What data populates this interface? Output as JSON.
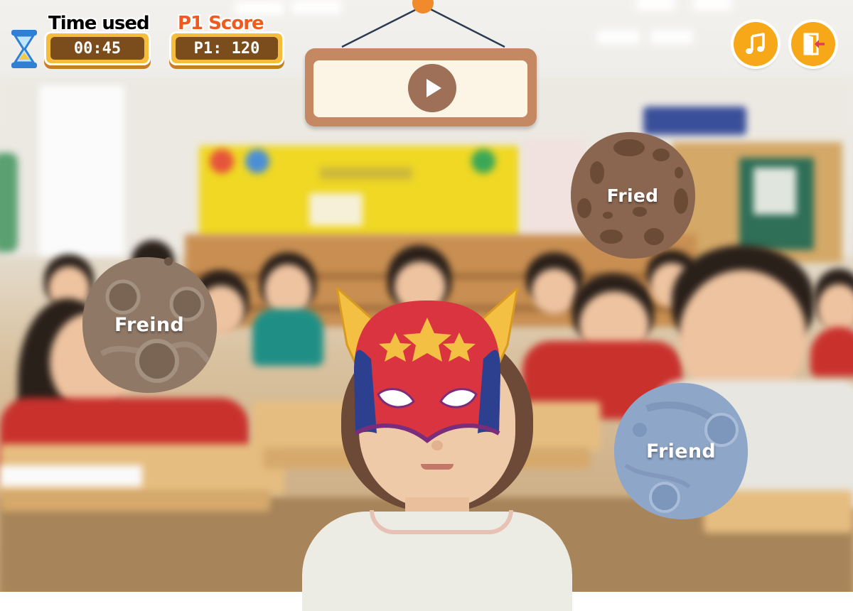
{
  "hud": {
    "time_label": "Time used",
    "time_value": "00:45",
    "score_label": "P1 Score",
    "score_value": "P1: 120",
    "colors": {
      "time_label": "#3c2b9e",
      "score_label": "#ef5a1f",
      "plaque": "#f5bd3a"
    }
  },
  "controls": {
    "music_icon": "music-note-icon",
    "exit_icon": "exit-door-icon",
    "play_icon": "play-icon"
  },
  "words": [
    {
      "text": "Freind",
      "style": "brown-cratered"
    },
    {
      "text": "Fried",
      "style": "red-brown-cratered"
    },
    {
      "text": "Friend",
      "style": "blue-grey"
    }
  ],
  "player": {
    "mask": "superhero-mask-red-gold-stars"
  }
}
